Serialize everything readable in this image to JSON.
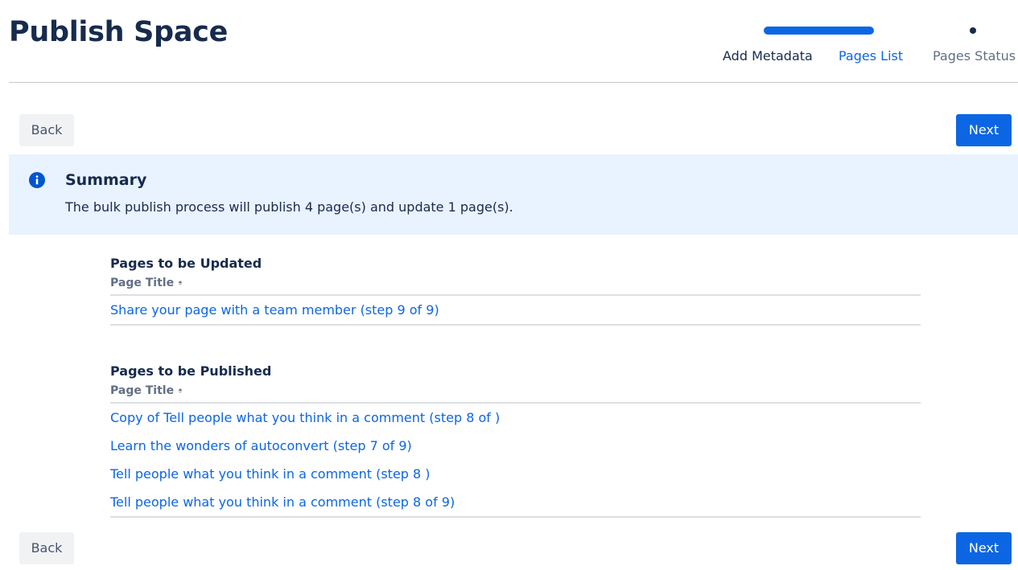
{
  "page": {
    "title": "Publish Space"
  },
  "tracker": {
    "steps": [
      {
        "label": "Add Metadata",
        "state": "completed"
      },
      {
        "label": "Pages List",
        "state": "current"
      },
      {
        "label": "Pages Status",
        "state": "upcoming"
      }
    ]
  },
  "buttons": {
    "back_label": "Back",
    "next_label": "Next"
  },
  "summary": {
    "icon": "info-icon",
    "title": "Summary",
    "text": "The bulk publish process will publish 4 page(s) and update 1 page(s)."
  },
  "updated": {
    "title": "Pages to be Updated",
    "column_header": "Page Title",
    "rows": [
      "Share your page with a team member (step 9 of 9)"
    ]
  },
  "published": {
    "title": "Pages to be Published",
    "column_header": "Page Title",
    "rows": [
      "Copy of Tell people what you think in a comment (step 8 of )",
      "Learn the wonders of autoconvert (step 7 of 9)",
      "Tell people what you think in a comment (step 8 )",
      "Tell people what you think in a comment (step 8 of 9)"
    ]
  },
  "colors": {
    "primary": "#0C66E4",
    "text": "#172B4D",
    "subtle_text": "#626F86",
    "info_background": "#E9F2FF",
    "info_icon": "#0055CC"
  }
}
